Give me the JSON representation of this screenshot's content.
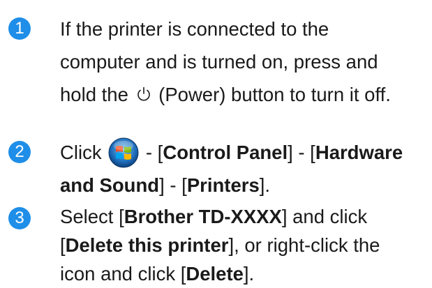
{
  "colors": {
    "badge": "#1e8ee8",
    "text": "#1a1a1a"
  },
  "steps": [
    {
      "number": "1",
      "lines": [
        "If the printer is connected to the",
        "computer and is turned on, press and",
        {
          "before": "hold the ",
          "icon": "power-icon",
          "after": " (Power) button to turn it off."
        }
      ]
    },
    {
      "number": "2",
      "line1": {
        "click": "Click ",
        "icon": "windows-start-icon",
        "sep1": " - [",
        "b1": "Control Panel",
        "sep2": "] - [",
        "b2": "Hardware"
      },
      "line2": {
        "b3": "and Sound",
        "sep3": "] - [",
        "b4": "Printers",
        "end": "]."
      }
    },
    {
      "number": "3",
      "line1": {
        "pre": "Select [",
        "b1": "Brother TD-XXXX",
        "post": "] and click"
      },
      "line2": {
        "pre": "[",
        "b2": "Delete this printer",
        "post": "], or right-click the"
      },
      "line3": {
        "pre": "icon and click [",
        "b3": "Delete",
        "post": "]."
      }
    }
  ]
}
